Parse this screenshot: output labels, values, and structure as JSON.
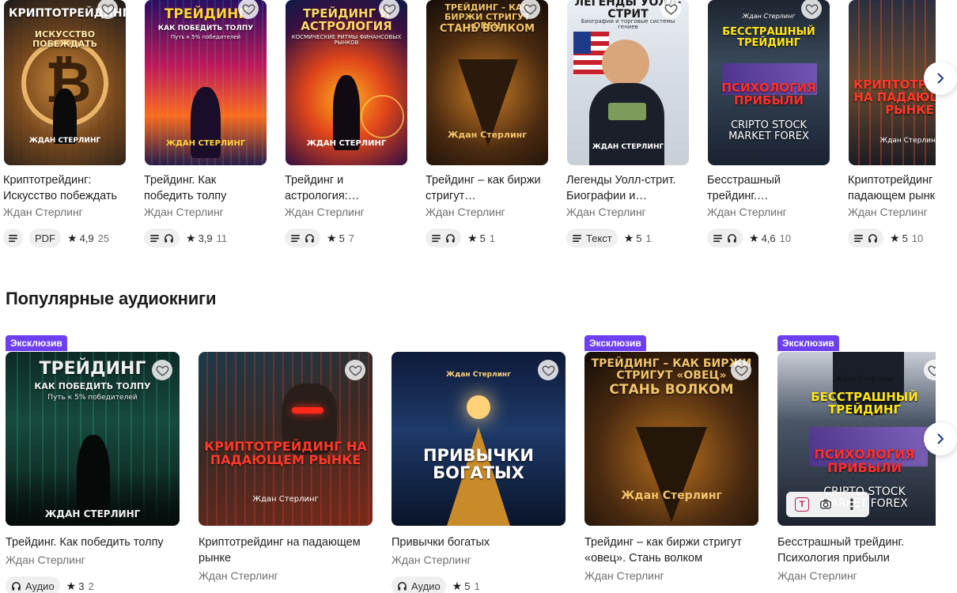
{
  "top_row": {
    "books": [
      {
        "title": "Криптотрейдинг: Искусство побеждать",
        "author": "Ждан Стерлинг",
        "cover_title": "КРИПТОТРЕЙДИНГ",
        "cover_subtitle": "ИСКУССТВО ПОБЕЖДАТЬ",
        "cover_author": "ЖДАН СТЕРЛИНГ",
        "format_label": "PDF",
        "rating": "4,9",
        "rating_count": "25",
        "icons": [
          "text-icon"
        ]
      },
      {
        "title": "Трейдинг. Как победить толпу",
        "author": "Ждан Стерлинг",
        "cover_title": "ТРЕЙДИНГ",
        "cover_subtitle": "КАК ПОБЕДИТЬ ТОЛПУ",
        "cover_tagline": "Путь к 5% победителей",
        "cover_author": "ЖДАН СТЕРЛИНГ",
        "rating": "3,9",
        "rating_count": "11",
        "icons": [
          "text-icon",
          "headphones-icon"
        ]
      },
      {
        "title": "Трейдинг и астрология:…",
        "author": "Ждан Стерлинг",
        "cover_title": "ТРЕЙДИНГ И АСТРОЛОГИЯ",
        "cover_subtitle": "КОСМИЧЕСКИЕ РИТМЫ ФИНАНСОВЫХ РЫНКОВ",
        "cover_author": "ЖДАН СТЕРЛИНГ",
        "rating": "5",
        "rating_count": "7",
        "icons": [
          "text-icon",
          "headphones-icon"
        ]
      },
      {
        "title": "Трейдинг – как биржи стригут…",
        "author": "Ждан Стерлинг",
        "cover_title": "ТРЕЙДИНГ – КАК БИРЖИ СТРИГУТ «ОВЕЦ»",
        "cover_subtitle": "СТАНЬ ВОЛКОМ",
        "cover_author": "Ждан Стерлинг",
        "rating": "5",
        "rating_count": "1",
        "icons": [
          "text-icon",
          "headphones-icon"
        ]
      },
      {
        "title": "Легенды Уолл-стрит. Биографии и…",
        "author": "Ждан Стерлинг",
        "cover_title": "ЛЕГЕНДЫ УОЛЛ-СТРИТ",
        "cover_subtitle": "Биографии и торговые системы гениев",
        "cover_author": "ЖДАН СТЕРЛИНГ",
        "format_label": "Текст",
        "rating": "5",
        "rating_count": "1",
        "icons": [
          "text-icon"
        ]
      },
      {
        "title": "Бесстрашный трейдинг.…",
        "author": "Ждан Стерлинг",
        "cover_title": "БЕССТРАШНЫЙ ТРЕЙДИНГ",
        "cover_subtitle": "ПСИХОЛОГИЯ ПРИБЫЛИ",
        "cover_tagline": "CRIPTO STOCK MARKET FOREX",
        "cover_author": "Ждан Стерлинг",
        "rating": "4,6",
        "rating_count": "10",
        "icons": [
          "text-icon",
          "headphones-icon"
        ]
      },
      {
        "title": "Криптотрейдинг на падающем рынке",
        "author": "Ждан Стерлинг",
        "cover_title": "КРИПТОТРЕЙДИНГ НА ПАДАЮЩЕМ РЫНКЕ",
        "cover_author": "Ждан Стерлинг",
        "rating": "5",
        "rating_count": "10",
        "icons": [
          "text-icon",
          "headphones-icon"
        ]
      }
    ]
  },
  "section": {
    "title": "Популярные аудиокниги"
  },
  "audio_row": {
    "books": [
      {
        "badge": "Эксклюзив",
        "title": "Трейдинг. Как победить толпу",
        "author": "Ждан Стерлинг",
        "cover_title": "ТРЕЙДИНГ",
        "cover_subtitle": "КАК ПОБЕДИТЬ ТОЛПУ",
        "cover_tagline": "Путь к 5% победителей",
        "cover_author": "ЖДАН СТЕРЛИНГ",
        "format_label": "Аудио",
        "rating": "3",
        "rating_count": "2"
      },
      {
        "badge": "",
        "title": "Криптотрейдинг на падающем рынке",
        "author": "Ждан Стерлинг",
        "cover_title": "КРИПТОТРЕЙДИНГ НА ПАДАЮЩЕМ РЫНКЕ",
        "cover_author": "Ждан Стерлинг"
      },
      {
        "badge": "",
        "title": "Привычки богатых",
        "author": "Ждан Стерлинг",
        "cover_title": "ПРИВЫЧКИ БОГАТЫХ",
        "cover_author": "Ждан Стерлинг",
        "format_label": "Аудио",
        "rating": "5",
        "rating_count": "1"
      },
      {
        "badge": "Эксклюзив",
        "title": "Трейдинг – как биржи стригут «овец». Стань волком",
        "author": "Ждан Стерлинг",
        "cover_title": "ТРЕЙДИНГ – КАК БИРЖИ СТРИГУТ «ОВЕЦ»",
        "cover_subtitle": "СТАНЬ ВОЛКОМ",
        "cover_author": "Ждан Стерлинг"
      },
      {
        "badge": "Эксклюзив",
        "title": "Бесстрашный трейдинг. Психология прибыли",
        "author": "Ждан Стерлинг",
        "cover_title": "БЕССТРАШНЫЙ ТРЕЙДИНГ",
        "cover_subtitle": "ПСИХОЛОГИЯ ПРИБЫЛИ",
        "cover_tagline": "CRIPTO STOCK MARKET FOREX",
        "cover_author": "Ждан Стерлинг"
      }
    ]
  },
  "colors": {
    "exclusive_badge": "#6d3ff0",
    "pill_bg": "#efeff0",
    "author_text": "#6f6f6f"
  },
  "icons": {
    "favorite": "heart-icon",
    "next": "chevron-right-icon",
    "text": "text-icon",
    "audio": "headphones-icon",
    "rating": "star-icon"
  }
}
